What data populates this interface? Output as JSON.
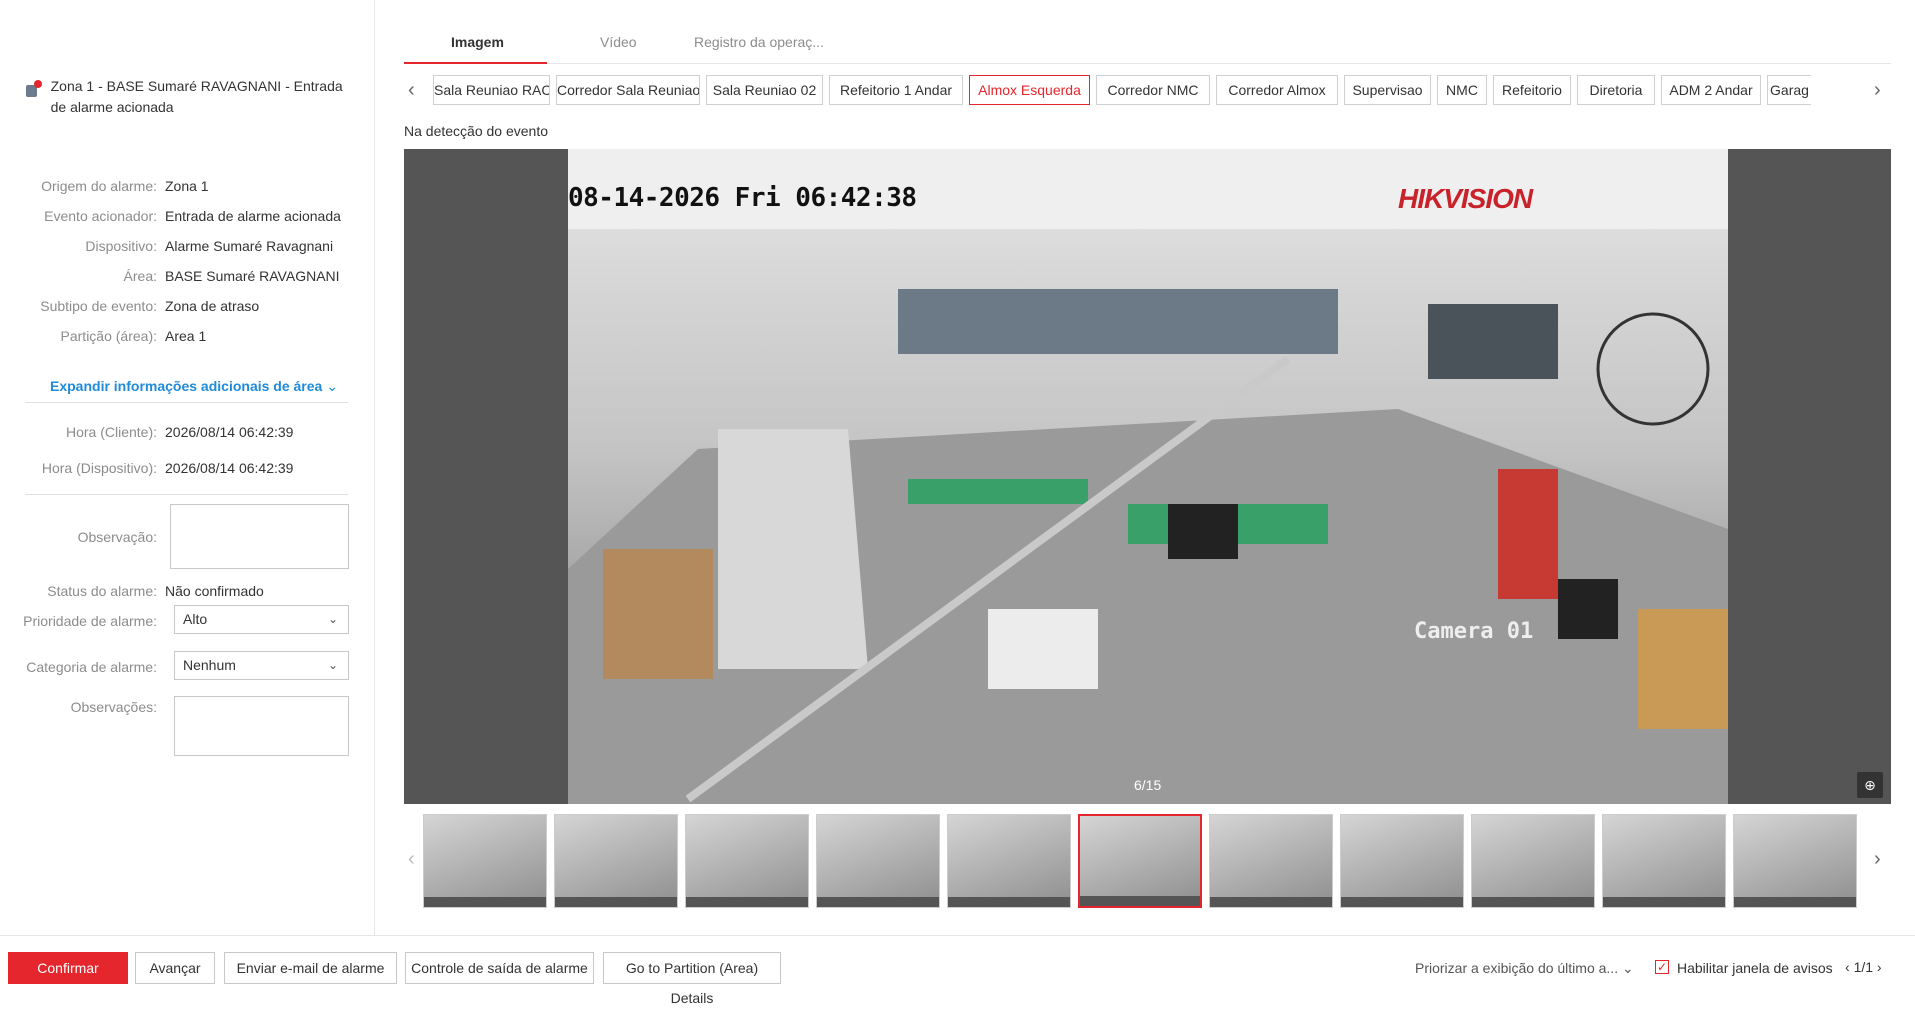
{
  "alarm": {
    "title": "Zona 1 - BASE Sumaré RAVAGNANI - Entrada de alarme acionada"
  },
  "details": [
    {
      "label": "Origem do alarme:",
      "value": "Zona 1"
    },
    {
      "label": "Evento acionador:",
      "value": "Entrada de alarme acionada"
    },
    {
      "label": "Dispositivo:",
      "value": "Alarme Sumaré Ravagnani"
    },
    {
      "label": "Área:",
      "value": "BASE Sumaré RAVAGNANI"
    },
    {
      "label": "Subtipo de evento:",
      "value": "Zona de atraso"
    },
    {
      "label": "Partição (área):",
      "value": "Area 1"
    }
  ],
  "expand_label": "Expandir informações adicionais de área",
  "times": [
    {
      "label": "Hora (Cliente):",
      "value": "2026/08/14 06:42:39"
    },
    {
      "label": "Hora (Dispositivo):",
      "value": "2026/08/14 06:42:39"
    }
  ],
  "form": {
    "observacao_label": "Observação:",
    "status_label": "Status do alarme:",
    "status_value": "Não confirmado",
    "prioridade_label": "Prioridade de alarme:",
    "prioridade_value": "Alto",
    "categoria_label": "Categoria de alarme:",
    "categoria_value": "Nenhum",
    "observacoes_label": "Observações:"
  },
  "tabs": [
    "Imagem",
    "Vídeo",
    "Registro da operaç..."
  ],
  "cameras": [
    "Sala Reuniao RACK",
    "Corredor Sala Reuniao",
    "Sala Reuniao 02",
    "Refeitorio 1 Andar",
    "Almox Esquerda",
    "Corredor NMC",
    "Corredor Almox",
    "Supervisao",
    "NMC",
    "Refeitorio",
    "Diretoria",
    "ADM 2 Andar",
    "Garag"
  ],
  "active_camera": "Almox Esquerda",
  "event_label": "Na detecção do evento",
  "image": {
    "osd_time": "08-14-2026 Fri 06:42:38",
    "brand": "HIKVISION",
    "osd_camera": "Camera 01",
    "counter": "6/15"
  },
  "thumbnails": {
    "visible": 11,
    "active_index": 5
  },
  "bottom": {
    "confirm": "Confirmar",
    "advance": "Avançar",
    "email": "Enviar e-mail de alarme",
    "output": "Controle de saída de alarme",
    "partition": "Go to Partition (Area) Details",
    "priority_display": "Priorizar a exibição do último a...",
    "enable_window": "Habilitar janela de avisos",
    "pager": "1/1"
  },
  "colors": {
    "accent": "#e5262d",
    "link": "#1f8bd9"
  }
}
